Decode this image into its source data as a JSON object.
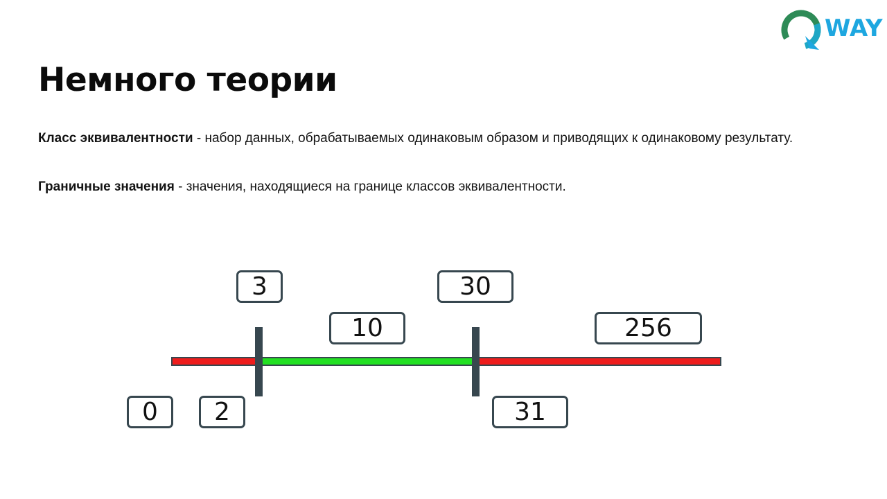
{
  "logo": {
    "text": "WAY",
    "letter": "Q",
    "brand_colors": [
      "#2e8b57",
      "#1ea7c5",
      "#1ea7e0"
    ]
  },
  "title": "Немного теории",
  "definitions": [
    {
      "term": "Класс эквивалентности",
      "text": " - набор данных, обрабатываемых одинаковым образом и приводящих к одинаковому результату."
    },
    {
      "term": "Граничные значения",
      "text": " - значения, находящиеся на границе классов эквивалентности."
    }
  ],
  "number_line": {
    "valid_color": "#22e022",
    "invalid_color": "#ee1c1c",
    "boundaries": [
      3,
      30
    ],
    "labels_above": [
      "3",
      "10",
      "30",
      "256"
    ],
    "labels_below": [
      "0",
      "2",
      "31"
    ]
  }
}
